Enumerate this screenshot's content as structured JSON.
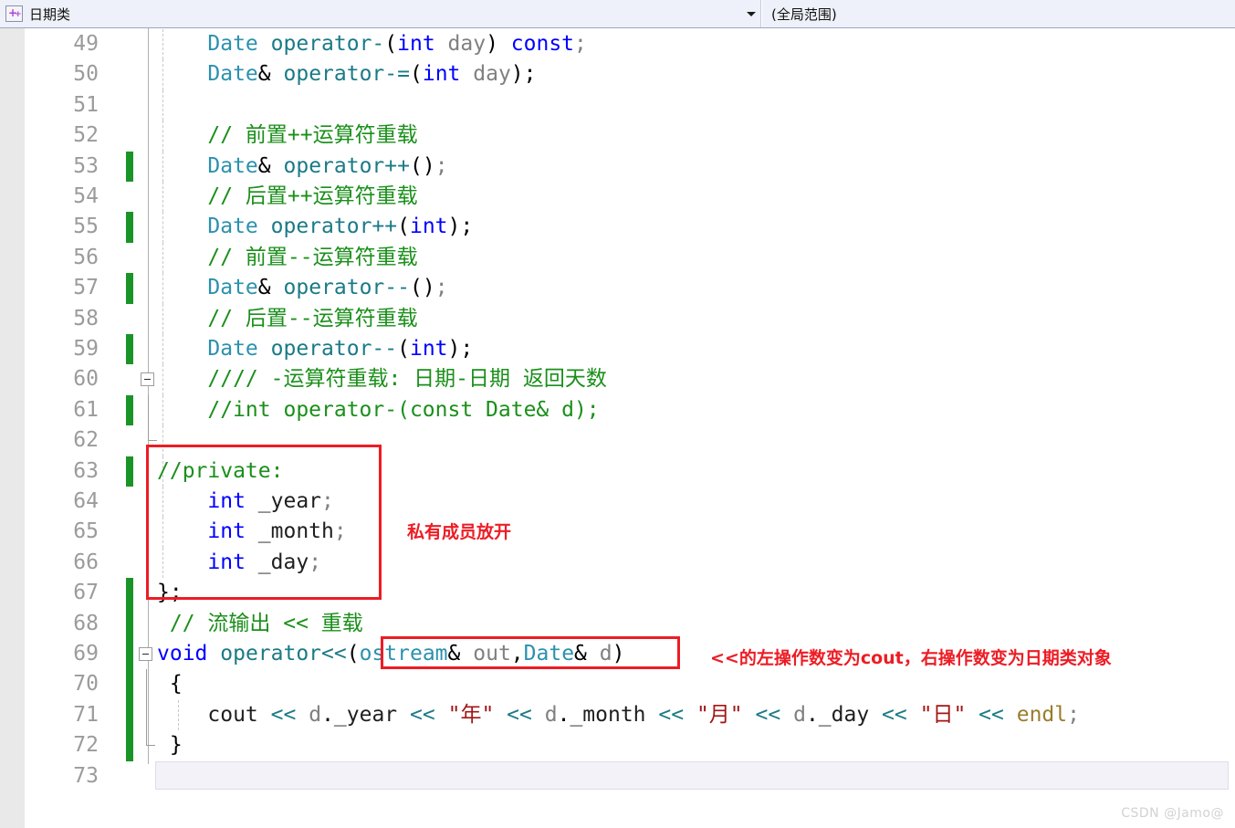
{
  "navbar": {
    "class_selector": {
      "icon": "cpp-class-icon",
      "label": "日期类",
      "dropdown_icon": "chevron-down-icon"
    },
    "member_selector": {
      "label": "(全局范围)"
    }
  },
  "editor": {
    "lines": [
      {
        "n": "49",
        "changed": false,
        "fold": "none",
        "guide": 1,
        "text": "    Date operator-(int day) const;",
        "tokens": [
          {
            "t": "    ",
            "c": "t-plain"
          },
          {
            "t": "Date",
            "c": "t-cls"
          },
          {
            "t": " ",
            "c": "t-plain"
          },
          {
            "t": "operator-",
            "c": "t-fn"
          },
          {
            "t": "(",
            "c": "t-black"
          },
          {
            "t": "int",
            "c": "t-kw"
          },
          {
            "t": " ",
            "c": "t-plain"
          },
          {
            "t": "day",
            "c": "t-var"
          },
          {
            "t": ")",
            "c": "t-black"
          },
          {
            "t": " ",
            "c": "t-plain"
          },
          {
            "t": "const",
            "c": "t-kw"
          },
          {
            "t": ";",
            "c": "t-var"
          }
        ]
      },
      {
        "n": "50",
        "changed": false,
        "fold": "none",
        "guide": 1,
        "text": "    Date& operator-=(int day);",
        "tokens": [
          {
            "t": "    ",
            "c": "t-plain"
          },
          {
            "t": "Date",
            "c": "t-cls"
          },
          {
            "t": "&",
            "c": "t-black"
          },
          {
            "t": " ",
            "c": "t-plain"
          },
          {
            "t": "operator-=",
            "c": "t-fn"
          },
          {
            "t": "(",
            "c": "t-black"
          },
          {
            "t": "int",
            "c": "t-kw"
          },
          {
            "t": " ",
            "c": "t-plain"
          },
          {
            "t": "day",
            "c": "t-var"
          },
          {
            "t": ");",
            "c": "t-black"
          }
        ]
      },
      {
        "n": "51",
        "changed": false,
        "fold": "none",
        "guide": 1,
        "text": "",
        "tokens": []
      },
      {
        "n": "52",
        "changed": false,
        "fold": "none",
        "guide": 1,
        "text": "    // 前置++运算符重载",
        "tokens": [
          {
            "t": "    ",
            "c": "t-plain"
          },
          {
            "t": "// 前置++运算符重载",
            "c": "t-cmt"
          }
        ]
      },
      {
        "n": "53",
        "changed": true,
        "fold": "none",
        "guide": 1,
        "text": "    Date& operator++();",
        "tokens": [
          {
            "t": "    ",
            "c": "t-plain"
          },
          {
            "t": "Date",
            "c": "t-cls"
          },
          {
            "t": "&",
            "c": "t-black"
          },
          {
            "t": " ",
            "c": "t-plain"
          },
          {
            "t": "operator++",
            "c": "t-fn"
          },
          {
            "t": "()",
            "c": "t-black"
          },
          {
            "t": ";",
            "c": "t-var"
          }
        ]
      },
      {
        "n": "54",
        "changed": false,
        "fold": "none",
        "guide": 1,
        "text": "    // 后置++运算符重载",
        "tokens": [
          {
            "t": "    ",
            "c": "t-plain"
          },
          {
            "t": "// 后置++运算符重载",
            "c": "t-cmt"
          }
        ]
      },
      {
        "n": "55",
        "changed": true,
        "fold": "none",
        "guide": 1,
        "text": "    Date operator++(int);",
        "tokens": [
          {
            "t": "    ",
            "c": "t-plain"
          },
          {
            "t": "Date",
            "c": "t-cls"
          },
          {
            "t": " ",
            "c": "t-plain"
          },
          {
            "t": "operator++",
            "c": "t-fn"
          },
          {
            "t": "(",
            "c": "t-black"
          },
          {
            "t": "int",
            "c": "t-kw"
          },
          {
            "t": ");",
            "c": "t-black"
          }
        ]
      },
      {
        "n": "56",
        "changed": false,
        "fold": "none",
        "guide": 1,
        "text": "    // 前置--运算符重载",
        "tokens": [
          {
            "t": "    ",
            "c": "t-plain"
          },
          {
            "t": "// 前置--运算符重载",
            "c": "t-cmt"
          }
        ]
      },
      {
        "n": "57",
        "changed": true,
        "fold": "none",
        "guide": 1,
        "text": "    Date& operator--();",
        "tokens": [
          {
            "t": "    ",
            "c": "t-plain"
          },
          {
            "t": "Date",
            "c": "t-cls"
          },
          {
            "t": "&",
            "c": "t-black"
          },
          {
            "t": " ",
            "c": "t-plain"
          },
          {
            "t": "operator--",
            "c": "t-fn"
          },
          {
            "t": "()",
            "c": "t-black"
          },
          {
            "t": ";",
            "c": "t-var"
          }
        ]
      },
      {
        "n": "58",
        "changed": false,
        "fold": "none",
        "guide": 1,
        "text": "    // 后置--运算符重载",
        "tokens": [
          {
            "t": "    ",
            "c": "t-plain"
          },
          {
            "t": "// 后置--运算符重载",
            "c": "t-cmt"
          }
        ]
      },
      {
        "n": "59",
        "changed": true,
        "fold": "none",
        "guide": 1,
        "text": "    Date operator--(int);",
        "tokens": [
          {
            "t": "    ",
            "c": "t-plain"
          },
          {
            "t": "Date",
            "c": "t-cls"
          },
          {
            "t": " ",
            "c": "t-plain"
          },
          {
            "t": "operator--",
            "c": "t-fn"
          },
          {
            "t": "(",
            "c": "t-black"
          },
          {
            "t": "int",
            "c": "t-kw"
          },
          {
            "t": ");",
            "c": "t-black"
          }
        ]
      },
      {
        "n": "60",
        "changed": false,
        "fold": "box",
        "guide": 1,
        "text": "    //// -运算符重载: 日期-日期 返回天数",
        "tokens": [
          {
            "t": "    ",
            "c": "t-plain"
          },
          {
            "t": "//// -运算符重载: 日期-日期 返回天数",
            "c": "t-cmt"
          }
        ]
      },
      {
        "n": "61",
        "changed": true,
        "fold": "line",
        "guide": 1,
        "text": "    //int operator-(const Date& d);",
        "tokens": [
          {
            "t": "    ",
            "c": "t-plain"
          },
          {
            "t": "//int operator-(const Date& d);",
            "c": "t-cmt"
          }
        ]
      },
      {
        "n": "62",
        "changed": false,
        "fold": "end",
        "guide": 1,
        "text": "",
        "tokens": []
      },
      {
        "n": "63",
        "changed": true,
        "fold": "none",
        "guide": 1,
        "text": "//private:",
        "tokens": [
          {
            "t": "//private:",
            "c": "t-cmt"
          }
        ]
      },
      {
        "n": "64",
        "changed": false,
        "fold": "none",
        "guide": 1,
        "text": "    int _year;",
        "tokens": [
          {
            "t": "    ",
            "c": "t-plain"
          },
          {
            "t": "int",
            "c": "t-kw"
          },
          {
            "t": " ",
            "c": "t-plain"
          },
          {
            "t": "_year",
            "c": "t-plain"
          },
          {
            "t": ";",
            "c": "t-var"
          }
        ]
      },
      {
        "n": "65",
        "changed": false,
        "fold": "none",
        "guide": 1,
        "text": "    int _month;",
        "tokens": [
          {
            "t": "    ",
            "c": "t-plain"
          },
          {
            "t": "int",
            "c": "t-kw"
          },
          {
            "t": " ",
            "c": "t-plain"
          },
          {
            "t": "_month",
            "c": "t-plain"
          },
          {
            "t": ";",
            "c": "t-var"
          }
        ]
      },
      {
        "n": "66",
        "changed": false,
        "fold": "none",
        "guide": 1,
        "text": "    int _day;",
        "tokens": [
          {
            "t": "    ",
            "c": "t-plain"
          },
          {
            "t": "int",
            "c": "t-kw"
          },
          {
            "t": " ",
            "c": "t-plain"
          },
          {
            "t": "_day",
            "c": "t-plain"
          },
          {
            "t": ";",
            "c": "t-var"
          }
        ]
      },
      {
        "n": "67",
        "changed": true,
        "fold": "none",
        "guide": 0,
        "text": "};",
        "tokens": [
          {
            "t": "};",
            "c": "t-black"
          }
        ]
      },
      {
        "n": "68",
        "changed": true,
        "fold": "none",
        "guide": 0,
        "text": " // 流输出 << 重载",
        "tokens": [
          {
            "t": " ",
            "c": "t-plain"
          },
          {
            "t": "// 流输出 << 重载",
            "c": "t-cmt"
          }
        ]
      },
      {
        "n": "69",
        "changed": true,
        "fold": "box2",
        "guide": 0,
        "text": "void operator<<(ostream& out,Date& d)",
        "tokens": [
          {
            "t": "void",
            "c": "t-kw"
          },
          {
            "t": " ",
            "c": "t-plain"
          },
          {
            "t": "operator<<",
            "c": "t-fn"
          },
          {
            "t": "(",
            "c": "t-black"
          },
          {
            "t": "ostream",
            "c": "t-cls"
          },
          {
            "t": "&",
            "c": "t-black"
          },
          {
            "t": " ",
            "c": "t-plain"
          },
          {
            "t": "out",
            "c": "t-var"
          },
          {
            "t": ",",
            "c": "t-black"
          },
          {
            "t": "Date",
            "c": "t-cls"
          },
          {
            "t": "&",
            "c": "t-black"
          },
          {
            "t": " ",
            "c": "t-plain"
          },
          {
            "t": "d",
            "c": "t-var"
          },
          {
            "t": ")",
            "c": "t-black"
          }
        ]
      },
      {
        "n": "70",
        "changed": true,
        "fold": "line2",
        "guide": 0,
        "text": " {",
        "tokens": [
          {
            "t": " {",
            "c": "t-black"
          }
        ]
      },
      {
        "n": "71",
        "changed": true,
        "fold": "line2",
        "guide": 2,
        "text": "    cout << d._year << \"年\" << d._month << \"月\" << d._day << \"日\" << endl;",
        "tokens": [
          {
            "t": "    ",
            "c": "t-plain"
          },
          {
            "t": "cout",
            "c": "t-plain"
          },
          {
            "t": " ",
            "c": "t-plain"
          },
          {
            "t": "<<",
            "c": "t-op"
          },
          {
            "t": " ",
            "c": "t-plain"
          },
          {
            "t": "d",
            "c": "t-var"
          },
          {
            "t": ".",
            "c": "t-black"
          },
          {
            "t": "_year",
            "c": "t-plain"
          },
          {
            "t": " ",
            "c": "t-plain"
          },
          {
            "t": "<<",
            "c": "t-op"
          },
          {
            "t": " ",
            "c": "t-plain"
          },
          {
            "t": "\"年\"",
            "c": "t-str"
          },
          {
            "t": " ",
            "c": "t-plain"
          },
          {
            "t": "<<",
            "c": "t-op"
          },
          {
            "t": " ",
            "c": "t-plain"
          },
          {
            "t": "d",
            "c": "t-var"
          },
          {
            "t": ".",
            "c": "t-black"
          },
          {
            "t": "_month",
            "c": "t-plain"
          },
          {
            "t": " ",
            "c": "t-plain"
          },
          {
            "t": "<<",
            "c": "t-op"
          },
          {
            "t": " ",
            "c": "t-plain"
          },
          {
            "t": "\"月\"",
            "c": "t-str"
          },
          {
            "t": " ",
            "c": "t-plain"
          },
          {
            "t": "<<",
            "c": "t-op"
          },
          {
            "t": " ",
            "c": "t-plain"
          },
          {
            "t": "d",
            "c": "t-var"
          },
          {
            "t": ".",
            "c": "t-black"
          },
          {
            "t": "_day",
            "c": "t-plain"
          },
          {
            "t": " ",
            "c": "t-plain"
          },
          {
            "t": "<<",
            "c": "t-op"
          },
          {
            "t": " ",
            "c": "t-plain"
          },
          {
            "t": "\"日\"",
            "c": "t-str"
          },
          {
            "t": " ",
            "c": "t-plain"
          },
          {
            "t": "<<",
            "c": "t-op"
          },
          {
            "t": " ",
            "c": "t-plain"
          },
          {
            "t": "endl",
            "c": "t-id"
          },
          {
            "t": ";",
            "c": "t-var"
          }
        ]
      },
      {
        "n": "72",
        "changed": true,
        "fold": "line2end",
        "guide": 0,
        "text": " }",
        "tokens": [
          {
            "t": " }",
            "c": "t-black"
          }
        ]
      },
      {
        "n": "73",
        "changed": false,
        "fold": "none",
        "guide": 0,
        "current": true,
        "text": "",
        "tokens": []
      }
    ]
  },
  "annotations": {
    "private_members_note": "私有成员放开",
    "operator_note": "<<的左操作数变为cout，右操作数变为日期类对象"
  },
  "watermark": "CSDN @Jamo@",
  "colors": {
    "annotation_red": "#ed1c24",
    "change_bar_green": "#1a9427",
    "comment_green": "#1a8f1a",
    "keyword_blue": "#0000ff",
    "class_teal": "#2b91af",
    "string_darkred": "#a31515",
    "navbar_bg": "#eef1f9"
  }
}
